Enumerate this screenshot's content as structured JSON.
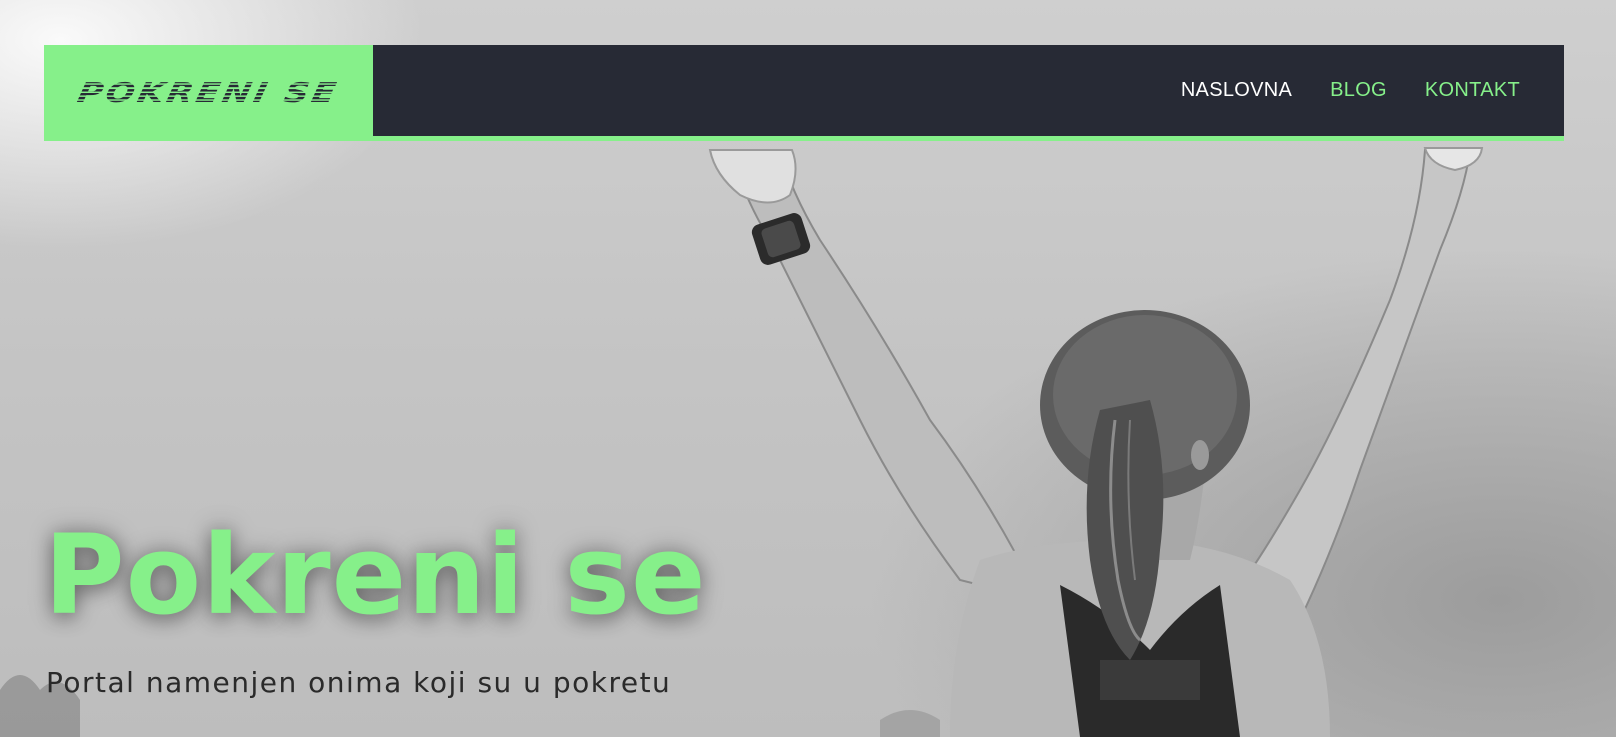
{
  "header": {
    "logo_text": "POKRENI SE",
    "nav": [
      {
        "label": "NASLOVNA"
      },
      {
        "label": "BLOG"
      },
      {
        "label": "KONTAKT"
      }
    ]
  },
  "hero": {
    "title": "Pokreni se",
    "subtitle": "Portal namenjen onima koji su u pokretu",
    "image_description": "woman-raising-arms-icon"
  },
  "colors": {
    "accent": "#86f08a",
    "header_bg": "#272a35",
    "nav_text": "#ffffff"
  }
}
